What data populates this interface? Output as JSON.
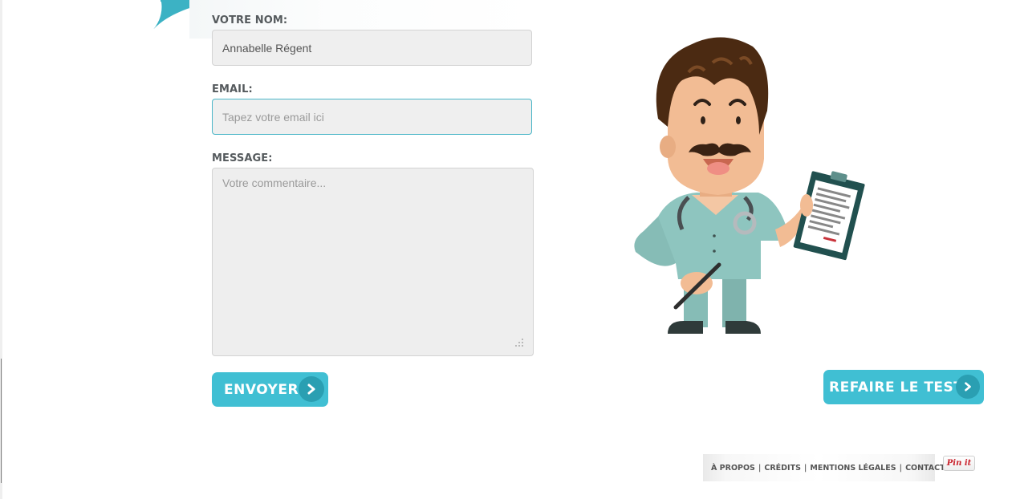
{
  "form": {
    "name_label": "VOTRE NOM:",
    "name_value": "Annabelle Régent",
    "email_label": "EMAIL:",
    "email_placeholder": "Tapez votre email ici",
    "message_label": "MESSAGE:",
    "message_placeholder": "Votre commentaire...",
    "send_label": "ENVOYER"
  },
  "retest_label": "REFAIRE LE TEST",
  "footer": {
    "links": [
      "À PROPOS",
      "CRÉDITS",
      "MENTIONS LÉGALES",
      "CONTACT"
    ],
    "separator": "|"
  },
  "pinit_label": "Pin it",
  "colors": {
    "accent": "#40bfd3",
    "accent_dark": "#2a9fb2",
    "field_bg": "#efefef",
    "label": "#555a5d"
  },
  "icons": [
    "chevron-right-icon",
    "resize-grip-icon",
    "doctor-illustration"
  ]
}
